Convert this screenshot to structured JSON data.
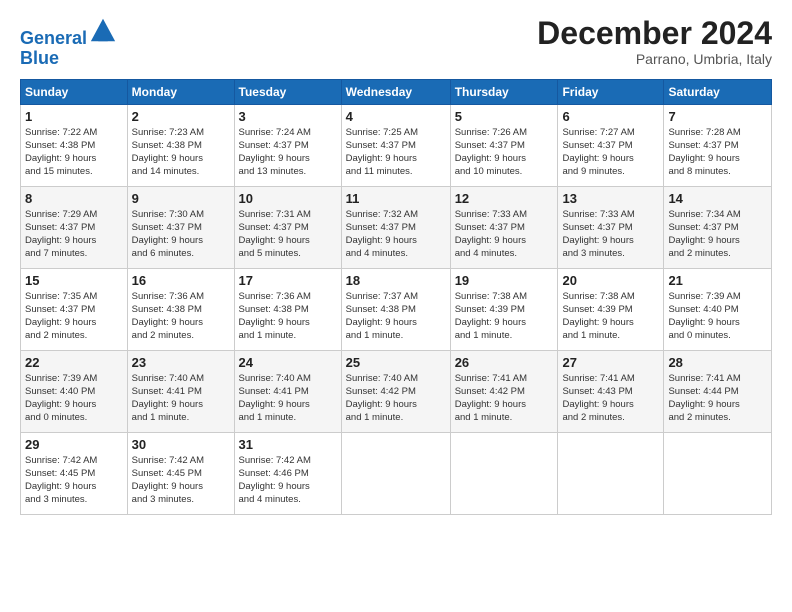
{
  "logo": {
    "line1": "General",
    "line2": "Blue"
  },
  "title": "December 2024",
  "location": "Parrano, Umbria, Italy",
  "days_of_week": [
    "Sunday",
    "Monday",
    "Tuesday",
    "Wednesday",
    "Thursday",
    "Friday",
    "Saturday"
  ],
  "weeks": [
    [
      {
        "day": "1",
        "info": "Sunrise: 7:22 AM\nSunset: 4:38 PM\nDaylight: 9 hours\nand 15 minutes."
      },
      {
        "day": "2",
        "info": "Sunrise: 7:23 AM\nSunset: 4:38 PM\nDaylight: 9 hours\nand 14 minutes."
      },
      {
        "day": "3",
        "info": "Sunrise: 7:24 AM\nSunset: 4:37 PM\nDaylight: 9 hours\nand 13 minutes."
      },
      {
        "day": "4",
        "info": "Sunrise: 7:25 AM\nSunset: 4:37 PM\nDaylight: 9 hours\nand 11 minutes."
      },
      {
        "day": "5",
        "info": "Sunrise: 7:26 AM\nSunset: 4:37 PM\nDaylight: 9 hours\nand 10 minutes."
      },
      {
        "day": "6",
        "info": "Sunrise: 7:27 AM\nSunset: 4:37 PM\nDaylight: 9 hours\nand 9 minutes."
      },
      {
        "day": "7",
        "info": "Sunrise: 7:28 AM\nSunset: 4:37 PM\nDaylight: 9 hours\nand 8 minutes."
      }
    ],
    [
      {
        "day": "8",
        "info": "Sunrise: 7:29 AM\nSunset: 4:37 PM\nDaylight: 9 hours\nand 7 minutes."
      },
      {
        "day": "9",
        "info": "Sunrise: 7:30 AM\nSunset: 4:37 PM\nDaylight: 9 hours\nand 6 minutes."
      },
      {
        "day": "10",
        "info": "Sunrise: 7:31 AM\nSunset: 4:37 PM\nDaylight: 9 hours\nand 5 minutes."
      },
      {
        "day": "11",
        "info": "Sunrise: 7:32 AM\nSunset: 4:37 PM\nDaylight: 9 hours\nand 4 minutes."
      },
      {
        "day": "12",
        "info": "Sunrise: 7:33 AM\nSunset: 4:37 PM\nDaylight: 9 hours\nand 4 minutes."
      },
      {
        "day": "13",
        "info": "Sunrise: 7:33 AM\nSunset: 4:37 PM\nDaylight: 9 hours\nand 3 minutes."
      },
      {
        "day": "14",
        "info": "Sunrise: 7:34 AM\nSunset: 4:37 PM\nDaylight: 9 hours\nand 2 minutes."
      }
    ],
    [
      {
        "day": "15",
        "info": "Sunrise: 7:35 AM\nSunset: 4:37 PM\nDaylight: 9 hours\nand 2 minutes."
      },
      {
        "day": "16",
        "info": "Sunrise: 7:36 AM\nSunset: 4:38 PM\nDaylight: 9 hours\nand 2 minutes."
      },
      {
        "day": "17",
        "info": "Sunrise: 7:36 AM\nSunset: 4:38 PM\nDaylight: 9 hours\nand 1 minute."
      },
      {
        "day": "18",
        "info": "Sunrise: 7:37 AM\nSunset: 4:38 PM\nDaylight: 9 hours\nand 1 minute."
      },
      {
        "day": "19",
        "info": "Sunrise: 7:38 AM\nSunset: 4:39 PM\nDaylight: 9 hours\nand 1 minute."
      },
      {
        "day": "20",
        "info": "Sunrise: 7:38 AM\nSunset: 4:39 PM\nDaylight: 9 hours\nand 1 minute."
      },
      {
        "day": "21",
        "info": "Sunrise: 7:39 AM\nSunset: 4:40 PM\nDaylight: 9 hours\nand 0 minutes."
      }
    ],
    [
      {
        "day": "22",
        "info": "Sunrise: 7:39 AM\nSunset: 4:40 PM\nDaylight: 9 hours\nand 0 minutes."
      },
      {
        "day": "23",
        "info": "Sunrise: 7:40 AM\nSunset: 4:41 PM\nDaylight: 9 hours\nand 1 minute."
      },
      {
        "day": "24",
        "info": "Sunrise: 7:40 AM\nSunset: 4:41 PM\nDaylight: 9 hours\nand 1 minute."
      },
      {
        "day": "25",
        "info": "Sunrise: 7:40 AM\nSunset: 4:42 PM\nDaylight: 9 hours\nand 1 minute."
      },
      {
        "day": "26",
        "info": "Sunrise: 7:41 AM\nSunset: 4:42 PM\nDaylight: 9 hours\nand 1 minute."
      },
      {
        "day": "27",
        "info": "Sunrise: 7:41 AM\nSunset: 4:43 PM\nDaylight: 9 hours\nand 2 minutes."
      },
      {
        "day": "28",
        "info": "Sunrise: 7:41 AM\nSunset: 4:44 PM\nDaylight: 9 hours\nand 2 minutes."
      }
    ],
    [
      {
        "day": "29",
        "info": "Sunrise: 7:42 AM\nSunset: 4:45 PM\nDaylight: 9 hours\nand 3 minutes."
      },
      {
        "day": "30",
        "info": "Sunrise: 7:42 AM\nSunset: 4:45 PM\nDaylight: 9 hours\nand 3 minutes."
      },
      {
        "day": "31",
        "info": "Sunrise: 7:42 AM\nSunset: 4:46 PM\nDaylight: 9 hours\nand 4 minutes."
      },
      null,
      null,
      null,
      null
    ]
  ]
}
